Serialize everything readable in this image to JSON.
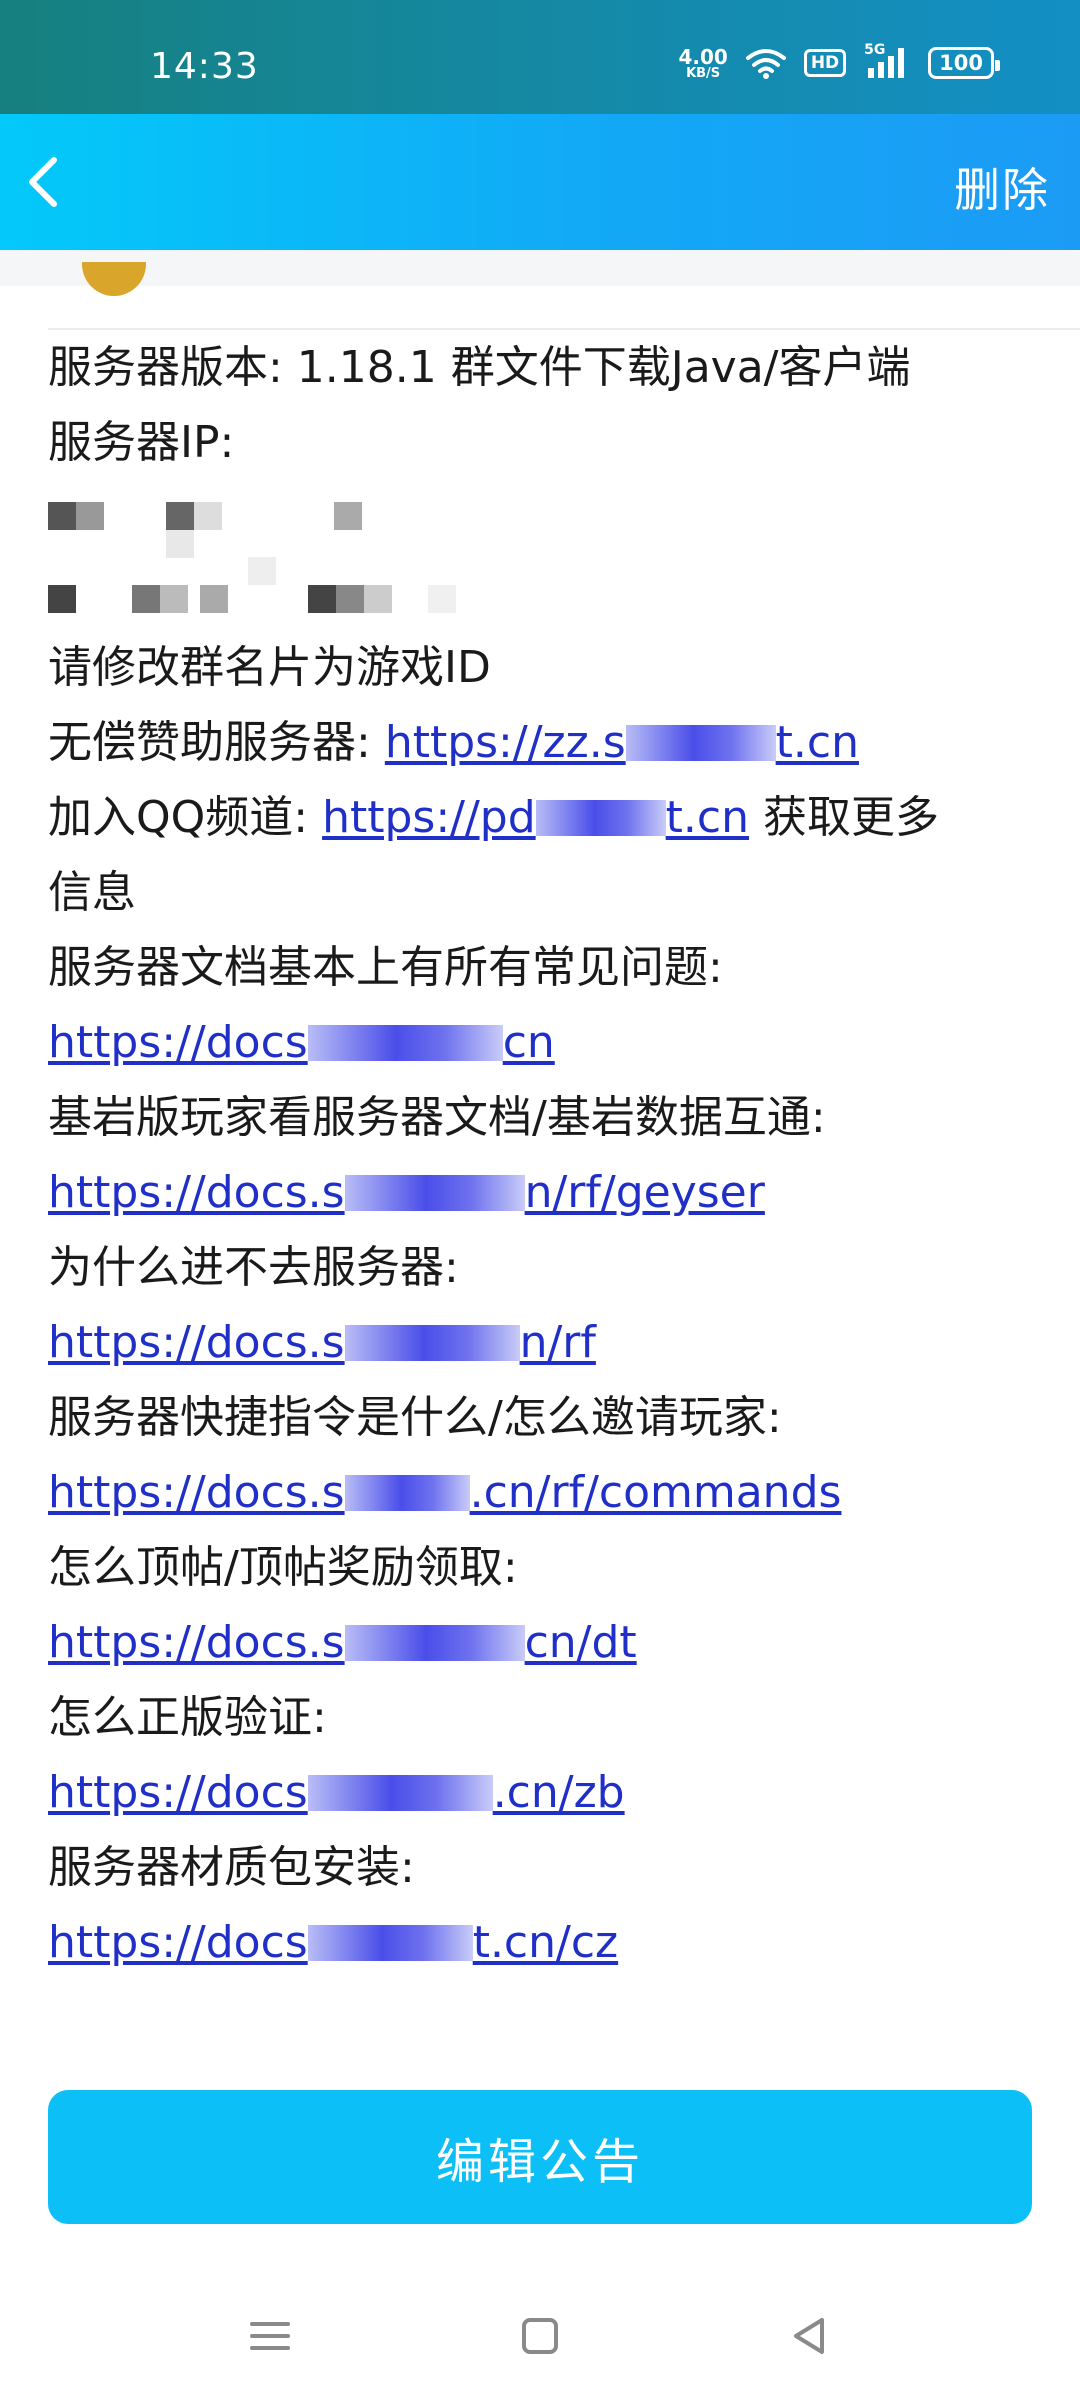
{
  "status_bar": {
    "time": "14:33",
    "net_speed": "4.00",
    "net_unit": "KB/S",
    "hd": "HD",
    "signal": "5G",
    "battery": "100"
  },
  "header": {
    "delete_label": "删除"
  },
  "announcement": {
    "version_line": "服务器版本: 1.18.1 群文件下载Java/客户端",
    "ip_label": "服务器IP:",
    "rename_note": "请修改群名片为游戏ID",
    "sponsor": {
      "label": "无偿赞助服务器: ",
      "link_start": "https://zz.s",
      "link_end": "t.cn"
    },
    "channel": {
      "label": "加入QQ频道: ",
      "link_start": "https://pd",
      "link_end": "t.cn",
      "suffix": " 获取更多",
      "wrap": "信息"
    },
    "docs_label": "服务器文档基本上有所有常见问题:",
    "docs_link": {
      "start": "https://docs",
      "end": "cn"
    },
    "bedrock_label": "基岩版玩家看服务器文档/基岩数据互通:",
    "bedrock_link": {
      "start": "https://docs.s",
      "end": "n/rf/geyser"
    },
    "cant_join_label": "为什么进不去服务器:",
    "cant_join_link": {
      "start": "https://docs.s",
      "end": "n/rf"
    },
    "commands_label": "服务器快捷指令是什么/怎么邀请玩家:",
    "commands_link": {
      "start": "https://docs.s",
      "end": ".cn/rf/commands"
    },
    "top_label": "怎么顶帖/顶帖奖励领取:",
    "top_link": {
      "start": "https://docs.s",
      "end": "cn/dt"
    },
    "verify_label": "怎么正版验证:",
    "verify_link": {
      "start": "https://docs",
      "end": ".cn/zb"
    },
    "texture_label": "服务器材质包安装:",
    "texture_link": {
      "start": "https://docs",
      "end": "t.cn/cz"
    }
  },
  "edit_button": {
    "label": "编辑公告"
  },
  "colors": {
    "accent": "#0cc0f7",
    "link": "#1f2fc8",
    "header_start": "#03c9f9",
    "header_end": "#1c9bf5"
  },
  "icons": [
    "back-chevron-icon",
    "wifi-icon",
    "signal-icon",
    "menu-icon",
    "home-icon",
    "back-triangle-icon"
  ]
}
